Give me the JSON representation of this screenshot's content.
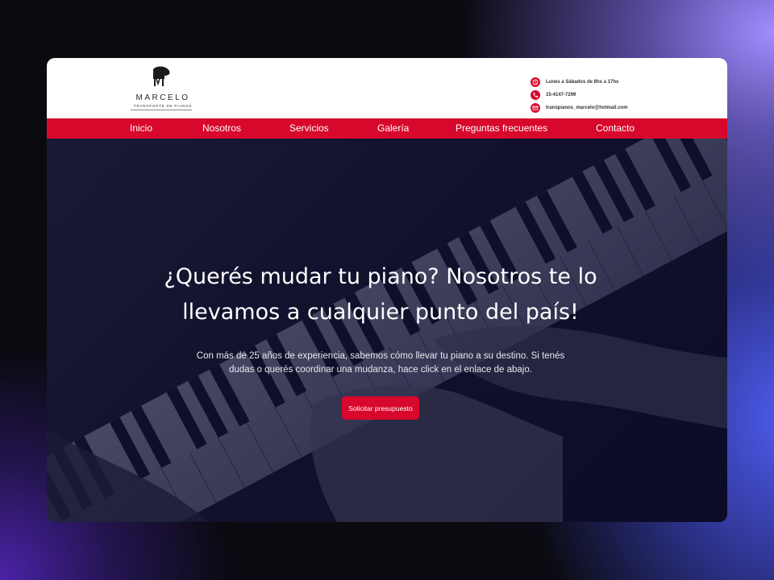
{
  "brand": {
    "name": "MARCELO",
    "tagline": "TRANSPORTE DE PIANOS",
    "logo_icon": "grand-piano-icon"
  },
  "contact": {
    "hours": "Lunes a Sábados de 8hs a 17hs",
    "phone": "15-4147-7299",
    "email": "transpianos_marcelo@hotmail.com"
  },
  "nav": {
    "items": [
      "Inicio",
      "Nosotros",
      "Servicios",
      "Galería",
      "Preguntas frecuentes",
      "Contacto"
    ]
  },
  "hero": {
    "title_line1": "¿Querés mudar tu piano? Nosotros te lo",
    "title_line2": "llevamos a cualquier punto del país!",
    "text_line1": "Con más de 25 años de experiencia, sabemos cómo llevar tu piano a su destino. Si tenés",
    "text_line2": "dudas o querés coordinar una mudanza, hace click en el enlace de abajo.",
    "cta_label": "Solicitar presupuesto"
  },
  "colors": {
    "accent": "#d7082b",
    "header_bg": "#ffffff",
    "hero_overlay": "#0b0b2e"
  }
}
